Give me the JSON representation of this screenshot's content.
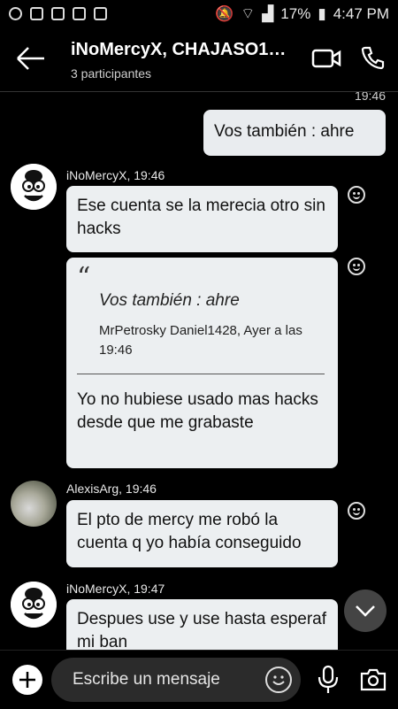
{
  "statusbar": {
    "battery": "17%",
    "time": "4:47 PM"
  },
  "header": {
    "title": "iNoMercyX, CHAJASO1…",
    "subtitle": "3 participantes"
  },
  "chat": {
    "top_time": "19:46",
    "outgoing": {
      "text": "Vos también :  ahre"
    },
    "group1": {
      "sender": "iNoMercyX, 19:46",
      "msg1": "Ese cuenta se la merecia otro sin hacks",
      "quote_mark": "“",
      "quote_text": "Vos también :  ahre",
      "quote_meta": "MrPetrosky Daniel1428, Ayer a las 19:46",
      "reply": "Yo no hubiese usado mas hacks desde que me grabaste"
    },
    "group2": {
      "sender": "AlexisArg, 19:46",
      "msg": "El pto de mercy me robó la cuenta q yo había conseguido"
    },
    "group3": {
      "sender": "iNoMercyX, 19:47",
      "msg": "Despues use y use hasta esperaf mi ban"
    }
  },
  "composer": {
    "placeholder": "Escribe un mensaje"
  }
}
